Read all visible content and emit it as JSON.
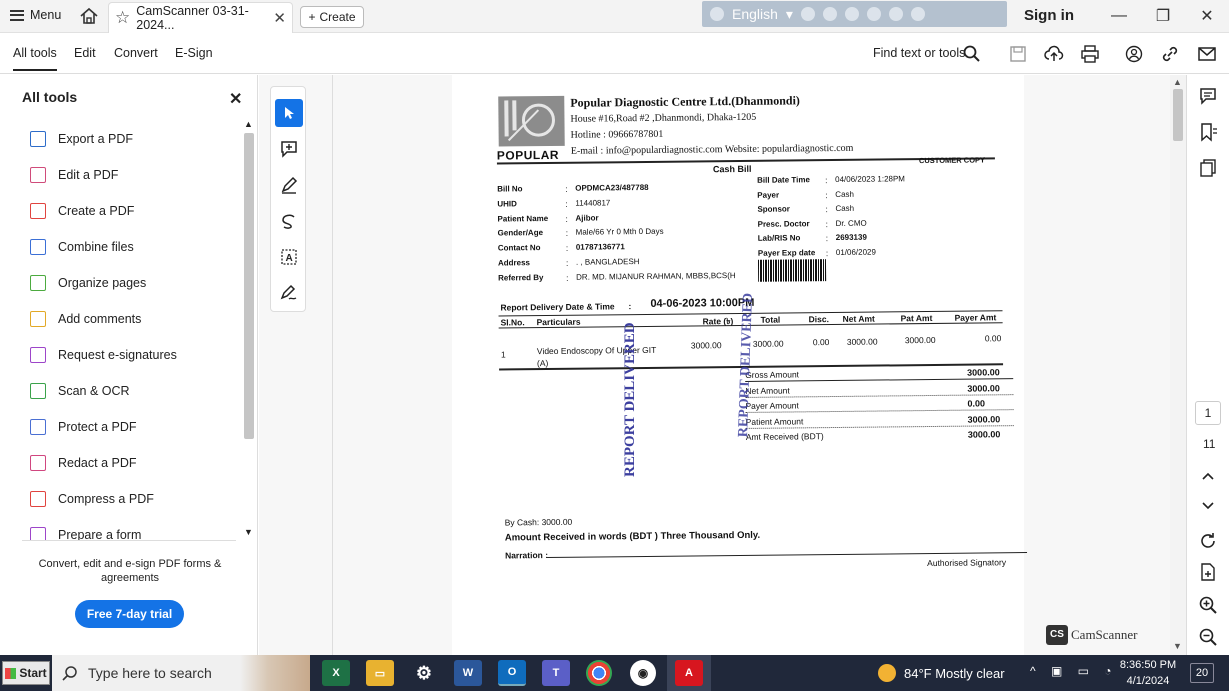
{
  "titlebar": {
    "menu_label": "Menu",
    "tab_title": "CamScanner 03-31-2024...",
    "create_label": "Create",
    "language": "English",
    "signin": "Sign in"
  },
  "toolbar": {
    "tabs": [
      "All tools",
      "Edit",
      "Convert",
      "E-Sign"
    ],
    "find_label": "Find text or tools"
  },
  "left_panel": {
    "title": "All tools",
    "items": [
      {
        "label": "Export a PDF",
        "icon": "export-pdf-icon",
        "color": "#2d6cc9"
      },
      {
        "label": "Edit a PDF",
        "icon": "edit-pdf-icon",
        "color": "#d04b7a"
      },
      {
        "label": "Create a PDF",
        "icon": "create-pdf-icon",
        "color": "#e0443f"
      },
      {
        "label": "Combine files",
        "icon": "combine-files-icon",
        "color": "#3b6fd6"
      },
      {
        "label": "Organize pages",
        "icon": "organize-pages-icon",
        "color": "#4caa3f"
      },
      {
        "label": "Add comments",
        "icon": "add-comments-icon",
        "color": "#e2a928"
      },
      {
        "label": "Request e-signatures",
        "icon": "request-esign-icon",
        "color": "#9d45c9"
      },
      {
        "label": "Scan & OCR",
        "icon": "scan-ocr-icon",
        "color": "#3aa24a"
      },
      {
        "label": "Protect a PDF",
        "icon": "protect-pdf-icon",
        "color": "#4a6fd3"
      },
      {
        "label": "Redact a PDF",
        "icon": "redact-pdf-icon",
        "color": "#d0467f"
      },
      {
        "label": "Compress a PDF",
        "icon": "compress-pdf-icon",
        "color": "#e0443f"
      },
      {
        "label": "Prepare a form",
        "icon": "prepare-form-icon",
        "color": "#9d45c9"
      }
    ],
    "promo_text": "Convert, edit and e-sign PDF forms & agreements",
    "trial_button": "Free 7-day trial"
  },
  "document": {
    "header": {
      "company": "Popular Diagnostic Centre Ltd.(Dhanmondi)",
      "address": "House #16,Road #2 ,Dhanmondi, Dhaka-1205",
      "hotline": "Hotline : 09666787801",
      "email_web": "E-mail : info@populardiagnostic.com  Website: populardiagnostic.com",
      "logo_text": "POPULAR",
      "bill_title": "Cash Bill",
      "copy_label": "CUSTOMER COPY"
    },
    "left_fields": [
      {
        "label": "Bill No",
        "value": "OPDMCA23/487788"
      },
      {
        "label": "UHID",
        "value": "11440817"
      },
      {
        "label": "Patient Name",
        "value": "Ajibor"
      },
      {
        "label": "Gender/Age",
        "value": "Male/66 Yr 0 Mth 0 Days"
      },
      {
        "label": "Contact No",
        "value": "01787136771"
      },
      {
        "label": "Address",
        "value": ". , BANGLADESH"
      },
      {
        "label": "Referred By",
        "value": "DR. MD. MIJANUR RAHMAN, MBBS,BCS(H"
      }
    ],
    "right_fields": [
      {
        "label": "Bill Date Time",
        "value": "04/06/2023  1:28PM"
      },
      {
        "label": "Payer",
        "value": "Cash"
      },
      {
        "label": "Sponsor",
        "value": "Cash"
      },
      {
        "label": "Presc. Doctor",
        "value": "Dr. CMO"
      },
      {
        "label": "Lab/RIS No",
        "value": "2693139"
      },
      {
        "label": "Payer Exp date",
        "value": "01/06/2029"
      }
    ],
    "delivery_label": "Report Delivery Date & Time",
    "delivery_value": "04-06-2023 10:00PM",
    "table_headers": [
      "Sl.No.",
      "Particulars",
      "Rate (৳)",
      "Total",
      "Disc.",
      "Net Amt",
      "Pat Amt",
      "Payer Amt"
    ],
    "row": {
      "sl": "1",
      "particulars": "Video Endoscopy Of Upper GIT",
      "particulars2": "(A)",
      "rate": "3000.00",
      "total": "3000.00",
      "disc": "0.00",
      "net": "3000.00",
      "pat": "3000.00",
      "payer": "0.00"
    },
    "summary": [
      {
        "label": "Gross Amount",
        "value": "3000.00"
      },
      {
        "label": "Net Amount",
        "value": "3000.00"
      },
      {
        "label": "Payer Amount",
        "value": "0.00"
      },
      {
        "label": "Patient Amount",
        "value": "3000.00"
      },
      {
        "label": "Amt Received (BDT)",
        "value": "3000.00"
      }
    ],
    "stamp_text": "REPORT DELIVERED",
    "by_cash": "By Cash: 3000.00",
    "words": "Amount Received in words (BDT ) Three  Thousand Only.",
    "narration": "Narration :",
    "signatory": "Authorised Signatory",
    "watermark": "CamScanner"
  },
  "rightrail": {
    "page_number": "1",
    "page_total": "11"
  },
  "taskbar": {
    "start": "Start",
    "search_placeholder": "Type here to search",
    "weather": "84°F  Mostly clear",
    "time": "8:36:50 PM",
    "date": "4/1/2024",
    "notifications": "20"
  }
}
